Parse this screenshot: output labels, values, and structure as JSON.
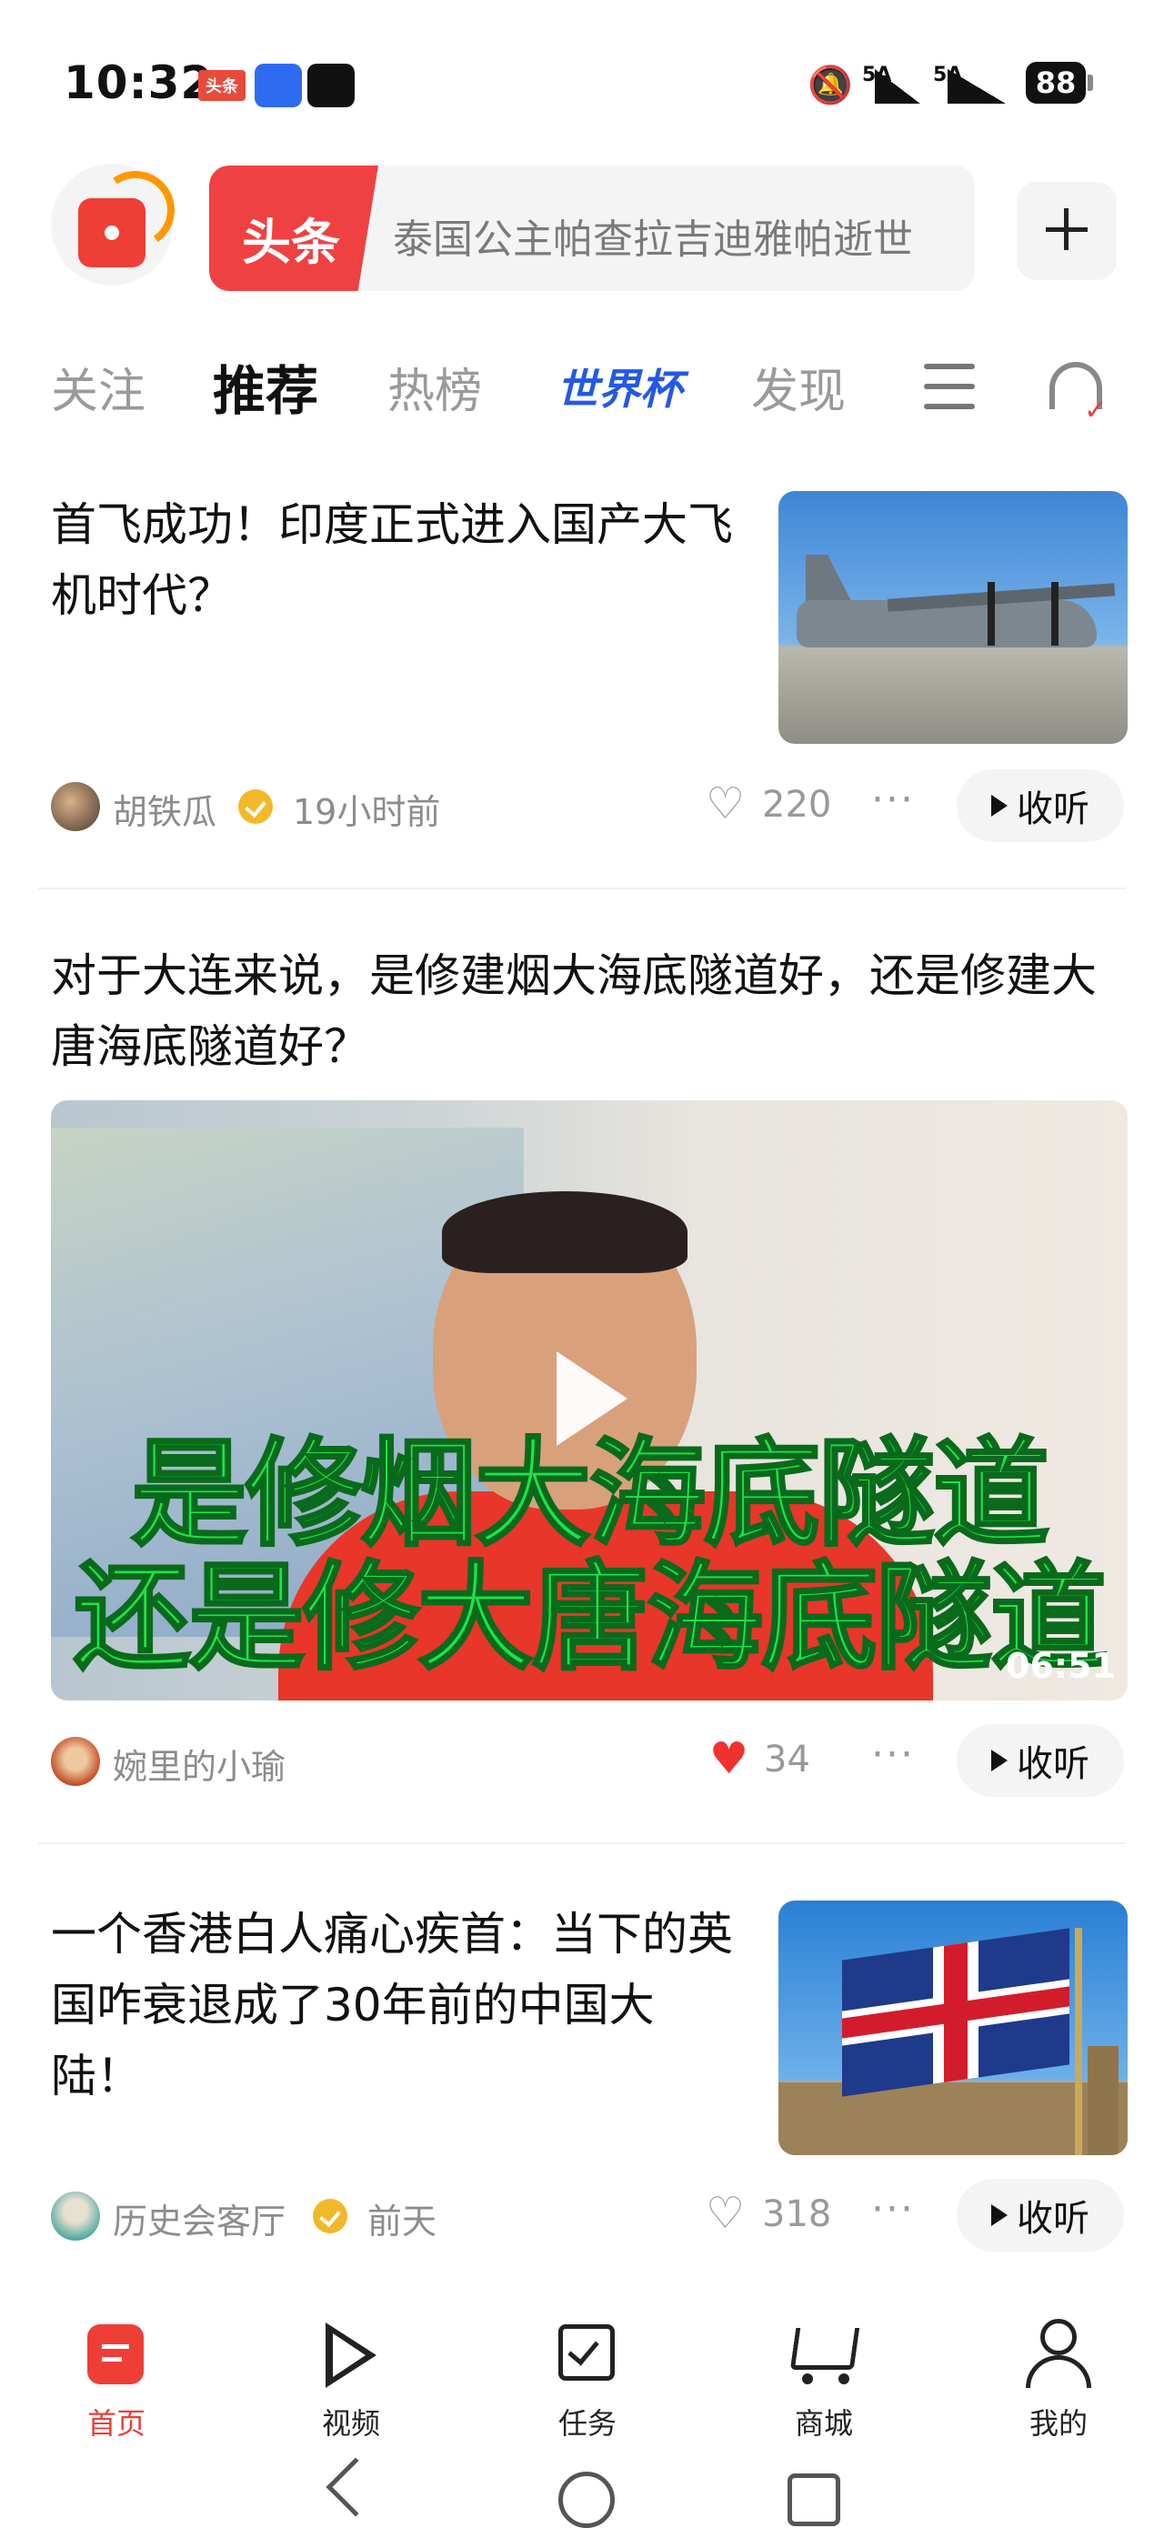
{
  "status_bar": {
    "time": "10:32",
    "news_badge": "头条",
    "signal1": "5A",
    "signal2": "5A",
    "battery": "88"
  },
  "header": {
    "brand": "头条",
    "search_placeholder": "泰国公主帕查拉吉迪雅帕逝世"
  },
  "tabs": [
    "关注",
    "推荐",
    "热榜",
    "世界杯",
    "发现"
  ],
  "feed": [
    {
      "title": "首飞成功！印度正式进入国产大飞机时代？",
      "author": "胡铁瓜",
      "time": "19小时前",
      "likes": "220",
      "listen": "收听"
    },
    {
      "title": "对于大连来说，是修建烟大海底隧道好，还是修建大唐海底隧道好？",
      "author": "婉里的小瑜",
      "likes": "34",
      "listen": "收听",
      "video_caption_1": "是修烟大海底隧道",
      "video_caption_2": "还是修大唐海底隧道",
      "duration": "06:51"
    },
    {
      "title": "一个香港白人痛心疾首：当下的英国咋衰退成了30年前的中国大陆！",
      "author": "历史会客厅",
      "time": "前天",
      "likes": "318",
      "listen": "收听"
    }
  ],
  "bottom_nav": [
    "首页",
    "视频",
    "任务",
    "商城",
    "我的"
  ],
  "colors": {
    "brand_red": "#ef3e36",
    "worldcup_blue": "#2458e6",
    "like_red": "#f0312f"
  }
}
